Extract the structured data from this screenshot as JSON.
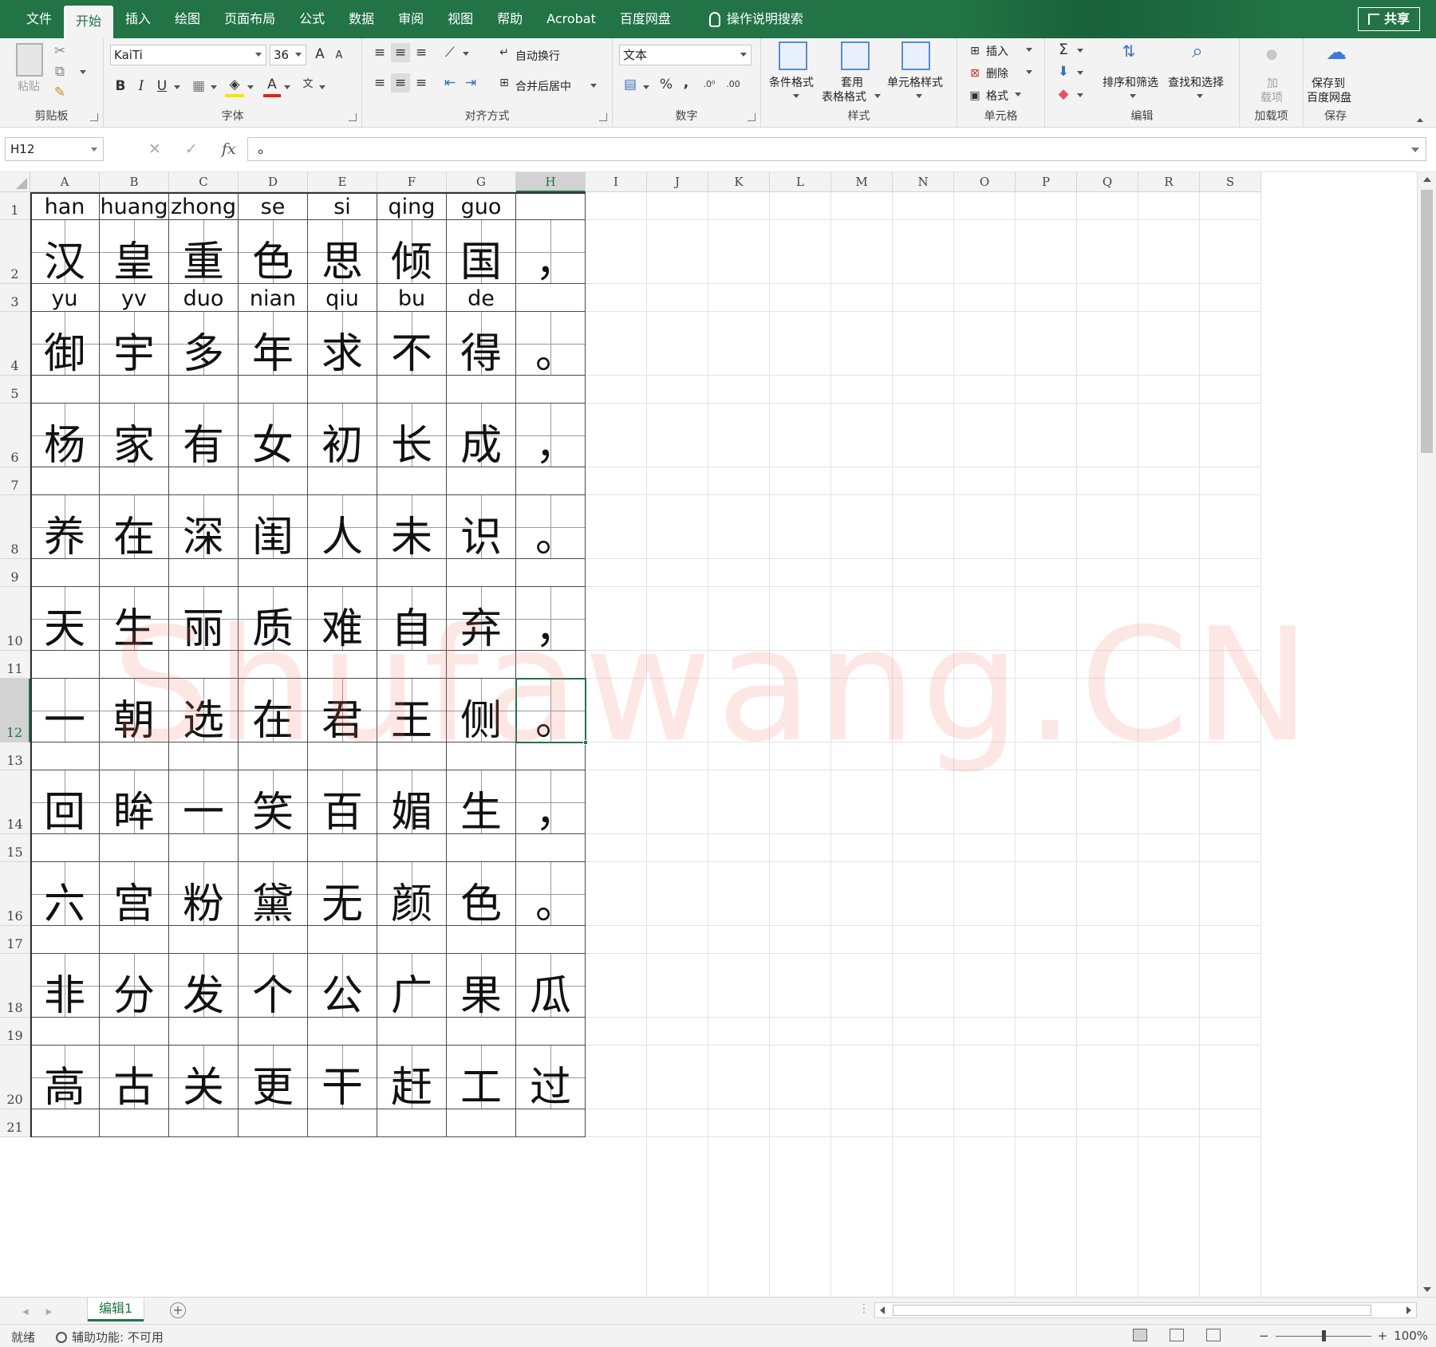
{
  "tabs": [
    {
      "label": "文件",
      "active": false
    },
    {
      "label": "开始",
      "active": true
    },
    {
      "label": "插入",
      "active": false
    },
    {
      "label": "绘图",
      "active": false
    },
    {
      "label": "页面布局",
      "active": false
    },
    {
      "label": "公式",
      "active": false
    },
    {
      "label": "数据",
      "active": false
    },
    {
      "label": "审阅",
      "active": false
    },
    {
      "label": "视图",
      "active": false
    },
    {
      "label": "帮助",
      "active": false
    },
    {
      "label": "Acrobat",
      "active": false
    },
    {
      "label": "百度网盘",
      "active": false
    }
  ],
  "tell_me": "操作说明搜索",
  "share_label": "共享",
  "ribbon": {
    "clipboard": {
      "paste": "粘贴",
      "group": "剪贴板"
    },
    "font": {
      "name": "KaiTi",
      "size": "36",
      "group": "字体"
    },
    "alignment": {
      "wrap": "自动换行",
      "merge": "合并后居中",
      "group": "对齐方式"
    },
    "number": {
      "format": "文本",
      "percent": "%",
      "comma": ",",
      "group": "数字"
    },
    "styles": {
      "conditional": "条件格式",
      "table_line1": "套用",
      "table_line2": "表格格式",
      "cell_styles": "单元格样式",
      "group": "样式"
    },
    "cells": {
      "insert": "插入",
      "delete": "删除",
      "format": "格式",
      "group": "单元格"
    },
    "editing": {
      "sort": "排序和筛选",
      "find": "查找和选择",
      "group": "编辑"
    },
    "addins": {
      "line1": "加",
      "line2": "载项",
      "group": "加载项"
    },
    "save": {
      "line1": "保存到",
      "line2": "百度网盘",
      "group": "保存"
    }
  },
  "formula_bar": {
    "name_box": "H12",
    "content": "。",
    "fx": "fx"
  },
  "columns": [
    "A",
    "B",
    "C",
    "D",
    "E",
    "F",
    "G",
    "H",
    "I",
    "J",
    "K",
    "L",
    "M",
    "N",
    "O",
    "P",
    "Q",
    "R",
    "S"
  ],
  "selected_column": "H",
  "rows": [
    {
      "num": "1",
      "kind": "pinyin",
      "cells": [
        "han",
        "huang",
        "zhong",
        "se",
        "si",
        "qing",
        "guo",
        ""
      ]
    },
    {
      "num": "2",
      "kind": "hanzi",
      "cells": [
        "汉",
        "皇",
        "重",
        "色",
        "思",
        "倾",
        "国",
        "，"
      ]
    },
    {
      "num": "3",
      "kind": "pinyin",
      "cells": [
        "yu",
        "yv",
        "duo",
        "nian",
        "qiu",
        "bu",
        "de",
        ""
      ]
    },
    {
      "num": "4",
      "kind": "hanzi",
      "cells": [
        "御",
        "宇",
        "多",
        "年",
        "求",
        "不",
        "得",
        "。"
      ]
    },
    {
      "num": "5",
      "kind": "pinyin",
      "cells": [
        "",
        "",
        "",
        "",
        "",
        "",
        "",
        ""
      ]
    },
    {
      "num": "6",
      "kind": "hanzi",
      "cells": [
        "杨",
        "家",
        "有",
        "女",
        "初",
        "长",
        "成",
        "，"
      ]
    },
    {
      "num": "7",
      "kind": "pinyin",
      "cells": [
        "",
        "",
        "",
        "",
        "",
        "",
        "",
        ""
      ]
    },
    {
      "num": "8",
      "kind": "hanzi",
      "cells": [
        "养",
        "在",
        "深",
        "闺",
        "人",
        "未",
        "识",
        "。"
      ]
    },
    {
      "num": "9",
      "kind": "pinyin",
      "cells": [
        "",
        "",
        "",
        "",
        "",
        "",
        "",
        ""
      ]
    },
    {
      "num": "10",
      "kind": "hanzi",
      "cells": [
        "天",
        "生",
        "丽",
        "质",
        "难",
        "自",
        "弃",
        "，"
      ]
    },
    {
      "num": "11",
      "kind": "pinyin",
      "cells": [
        "",
        "",
        "",
        "",
        "",
        "",
        "",
        ""
      ]
    },
    {
      "num": "12",
      "kind": "hanzi",
      "cells": [
        "一",
        "朝",
        "选",
        "在",
        "君",
        "王",
        "侧",
        "。"
      ]
    },
    {
      "num": "13",
      "kind": "pinyin",
      "cells": [
        "",
        "",
        "",
        "",
        "",
        "",
        "",
        ""
      ]
    },
    {
      "num": "14",
      "kind": "hanzi",
      "cells": [
        "回",
        "眸",
        "一",
        "笑",
        "百",
        "媚",
        "生",
        "，"
      ]
    },
    {
      "num": "15",
      "kind": "pinyin",
      "cells": [
        "",
        "",
        "",
        "",
        "",
        "",
        "",
        ""
      ]
    },
    {
      "num": "16",
      "kind": "hanzi",
      "cells": [
        "六",
        "宫",
        "粉",
        "黛",
        "无",
        "颜",
        "色",
        "。"
      ]
    },
    {
      "num": "17",
      "kind": "pinyin",
      "cells": [
        "",
        "",
        "",
        "",
        "",
        "",
        "",
        ""
      ]
    },
    {
      "num": "18",
      "kind": "hanzi",
      "cells": [
        "非",
        "分",
        "发",
        "个",
        "公",
        "广",
        "果",
        "瓜"
      ]
    },
    {
      "num": "19",
      "kind": "pinyin",
      "cells": [
        "",
        "",
        "",
        "",
        "",
        "",
        "",
        ""
      ]
    },
    {
      "num": "20",
      "kind": "hanzi",
      "cells": [
        "高",
        "古",
        "关",
        "更",
        "干",
        "赶",
        "工",
        "过"
      ]
    },
    {
      "num": "21",
      "kind": "pinyin",
      "cells": [
        "",
        "",
        "",
        "",
        "",
        "",
        "",
        ""
      ]
    }
  ],
  "selected_cell": {
    "row": "12",
    "col": "H"
  },
  "watermark": "Shufawang.CN",
  "sheet_tab": "编辑1",
  "status": {
    "ready": "就绪",
    "accessibility": "辅助功能: 不可用",
    "zoom": "100%"
  },
  "colors": {
    "excel_green": "#217346",
    "tabbar": "#227447"
  }
}
